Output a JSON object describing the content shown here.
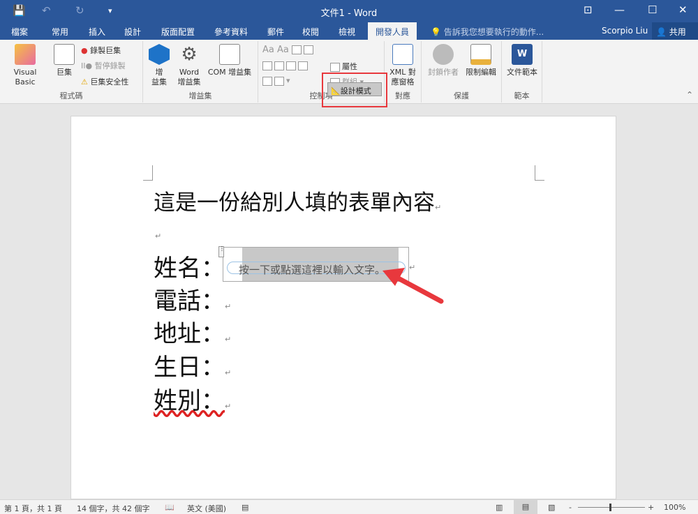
{
  "titlebar": {
    "title": "文件1 - Word",
    "save_icon": "💾",
    "undo_icon": "↶",
    "redo_icon": "↻",
    "customize_icon": "▾",
    "ribbon_display_icon": "⊡",
    "minimize_icon": "—",
    "maximize_icon": "☐",
    "close_icon": "✕"
  },
  "tabs": [
    "檔案",
    "常用",
    "插入",
    "設計",
    "版面配置",
    "參考資料",
    "郵件",
    "校閱",
    "檢視",
    "開發人員"
  ],
  "tell_me": "告訴我您想要執行的動作...",
  "user": "Scorpio Liu",
  "share": "共用",
  "ribbon": {
    "code": {
      "label": "程式碼",
      "visual_basic": "Visual Basic",
      "macros": "巨集",
      "record": "錄製巨集",
      "pause": "暫停錄製",
      "security": "巨集安全性"
    },
    "addins": {
      "label": "增益集",
      "addins": "增\n益集",
      "word_addins": "Word\n增益集",
      "com_addins": "COM 增益集"
    },
    "controls": {
      "label": "控制項",
      "design_mode": "設計模式",
      "properties": "屬性",
      "group": "群組"
    },
    "mapping": {
      "label": "對應",
      "xml": "XML 對\n應窗格"
    },
    "protect": {
      "label": "保護",
      "block": "封鎖作者",
      "restrict": "限制編輯"
    },
    "templates": {
      "label": "範本",
      "doc_template": "文件範本"
    }
  },
  "document": {
    "title": "這是一份給別人填的表單內容",
    "fields": [
      "姓名：",
      "電話：",
      "地址：",
      "生日：",
      "姓別："
    ],
    "placeholder": "按一下或點選這裡以輸入文字。",
    "para_mark": "↵"
  },
  "status": {
    "page": "第 1 頁，共 1 頁",
    "words": "14 個字，共 42 個字",
    "language": "英文 (美國)",
    "zoom": "100%",
    "zoom_minus": "-",
    "zoom_plus": "+"
  }
}
